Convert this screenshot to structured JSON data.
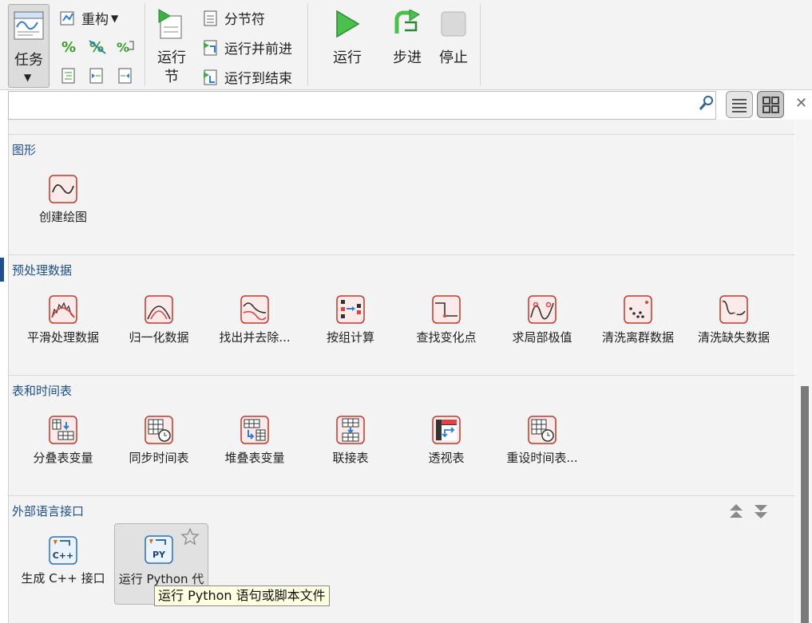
{
  "toolstrip": {
    "task_label": "任务",
    "refactor_label": "重构",
    "run_section_label_1": "运行",
    "run_section_label_2": "节",
    "section_break_label": "分节符",
    "run_advance_label": "运行并前进",
    "run_to_end_label": "运行到结束",
    "run_label": "运行",
    "step_label": "步进",
    "stop_label": "停止"
  },
  "search": {
    "placeholder": "",
    "value": ""
  },
  "sections": [
    {
      "title": "图形",
      "items": [
        {
          "label": "创建绘图",
          "icon": "plot-icon"
        }
      ]
    },
    {
      "title": "预处理数据",
      "items": [
        {
          "label": "平滑处理数据",
          "icon": "smooth-data-icon"
        },
        {
          "label": "归一化数据",
          "icon": "normalize-data-icon"
        },
        {
          "label": "找出并去除...",
          "icon": "trend-icon"
        },
        {
          "label": "按组计算",
          "icon": "group-compute-icon"
        },
        {
          "label": "查找变化点",
          "icon": "change-point-icon"
        },
        {
          "label": "求局部极值",
          "icon": "local-extrema-icon"
        },
        {
          "label": "清洗离群数据",
          "icon": "outlier-icon"
        },
        {
          "label": "清洗缺失数据",
          "icon": "missing-data-icon"
        }
      ]
    },
    {
      "title": "表和时间表",
      "items": [
        {
          "label": "分叠表变量",
          "icon": "unstack-icon"
        },
        {
          "label": "同步时间表",
          "icon": "synchronize-timetable-icon"
        },
        {
          "label": "堆叠表变量",
          "icon": "stack-icon"
        },
        {
          "label": "联接表",
          "icon": "join-table-icon"
        },
        {
          "label": "透视表",
          "icon": "pivot-table-icon"
        },
        {
          "label": "重设时间表...",
          "icon": "retime-icon"
        }
      ]
    },
    {
      "title": "外部语言接口",
      "items": [
        {
          "label": "生成 C++ 接口",
          "icon": "cpp-icon"
        },
        {
          "label": "运行 Python 代",
          "icon": "python-icon"
        }
      ]
    }
  ],
  "tooltip": "运行 Python 语句或脚本文件",
  "colors": {
    "accent": "#1d4f8c",
    "icon_border": "#c0392b",
    "run_green": "#3cb043"
  }
}
